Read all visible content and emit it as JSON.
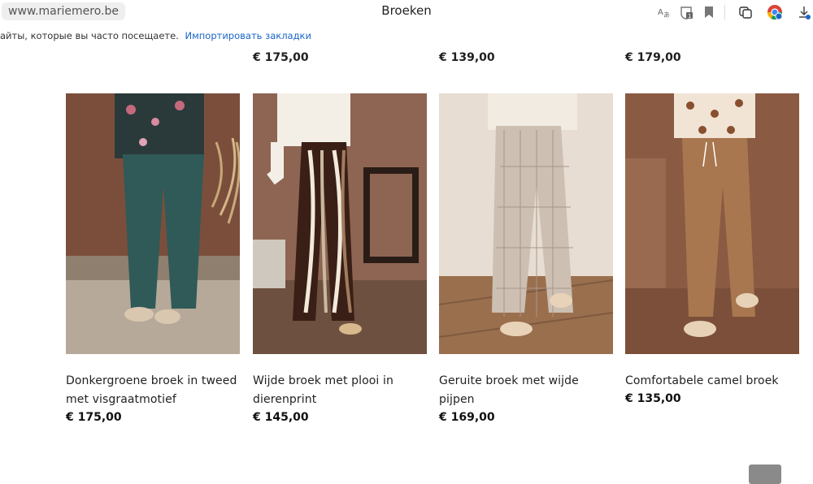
{
  "browser": {
    "url": "www.mariemero.be",
    "title": "Broeken"
  },
  "bookmarks_bar": {
    "hint": "айты, которые вы часто посещаете.",
    "import_link": "Импортировать закладки"
  },
  "top_prices": [
    "€ 175,00",
    "€ 139,00",
    "€ 179,00"
  ],
  "products": [
    {
      "name": "Donkergroene broek in tweed met visgraatmotief",
      "price": "€ 175,00",
      "color": "#2f5a57"
    },
    {
      "name": "Wijde broek met plooi in dierenprint",
      "price": "€ 145,00",
      "color": "#4a2a1f"
    },
    {
      "name": "Geruite broek met wijde pijpen",
      "price": "€ 169,00",
      "color": "#cdbfb2"
    },
    {
      "name": "Comfortabele camel broek",
      "price": "€ 135,00",
      "color": "#a9774f"
    }
  ]
}
